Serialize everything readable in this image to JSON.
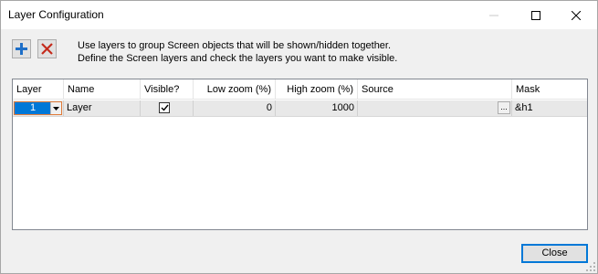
{
  "window": {
    "title": "Layer Configuration"
  },
  "toolbar": {
    "add_icon": "plus-icon",
    "remove_icon": "x-icon"
  },
  "instructions": {
    "line1": "Use layers to group Screen objects that will be shown/hidden together.",
    "line2": "Define the Screen layers and check the layers you want to make visible."
  },
  "grid": {
    "columns": [
      "Layer",
      "Name",
      "Visible?",
      "Low zoom (%)",
      "High zoom (%)",
      "Source",
      "Mask"
    ],
    "rows": [
      {
        "layer": "1",
        "name": "Layer",
        "visible": true,
        "low_zoom": "0",
        "high_zoom": "1000",
        "source": "",
        "mask": "&h1",
        "browse_label": "..."
      }
    ]
  },
  "footer": {
    "close_label": "Close"
  },
  "colors": {
    "accent": "#0078d7",
    "add_icon": "#1e6fc8",
    "remove_icon": "#c42b1c"
  }
}
